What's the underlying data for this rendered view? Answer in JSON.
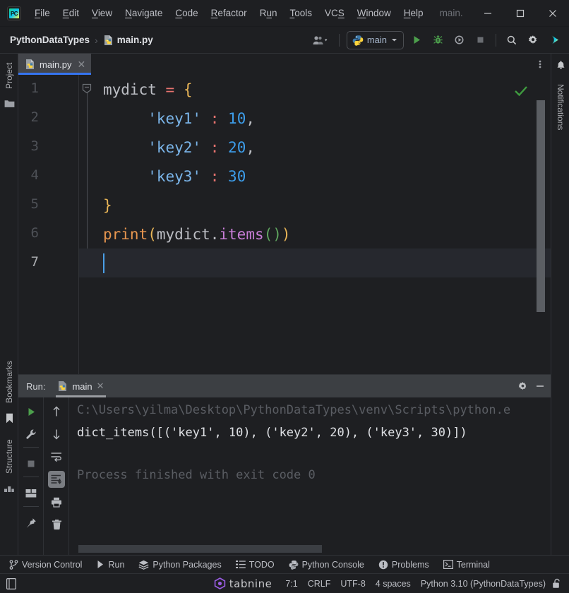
{
  "window": {
    "app_icon": "pycharm-logo-icon",
    "project_title_dim": "main.",
    "minimize": "minimize-icon",
    "maximize": "maximize-icon",
    "close": "close-icon"
  },
  "menu": {
    "items": [
      {
        "label": "File",
        "mnemonic": "F"
      },
      {
        "label": "Edit",
        "mnemonic": "E"
      },
      {
        "label": "View",
        "mnemonic": "V"
      },
      {
        "label": "Navigate",
        "mnemonic": "N"
      },
      {
        "label": "Code",
        "mnemonic": "C"
      },
      {
        "label": "Refactor",
        "mnemonic": "R"
      },
      {
        "label": "Run",
        "mnemonic": "u"
      },
      {
        "label": "Tools",
        "mnemonic": "T"
      },
      {
        "label": "VCS",
        "mnemonic": "S"
      },
      {
        "label": "Window",
        "mnemonic": "W"
      },
      {
        "label": "Help",
        "mnemonic": "H"
      }
    ]
  },
  "navbar": {
    "project": "PythonDataTypes",
    "separator": "›",
    "file": "main.py",
    "account_icon": "user-account-icon",
    "run_config": {
      "icon": "python-file-icon",
      "name": "main",
      "chevron": "chevron-down-icon"
    },
    "actions": [
      {
        "name": "run-button",
        "icon": "run-play-icon",
        "label": "Run"
      },
      {
        "name": "debug-button",
        "icon": "debug-bug-icon",
        "label": "Debug"
      },
      {
        "name": "run-with-coverage-button",
        "icon": "coverage-icon",
        "label": "Run with Coverage"
      },
      {
        "name": "stop-button",
        "icon": "stop-square-icon",
        "label": "Stop"
      },
      {
        "name": "search-everywhere-button",
        "icon": "search-icon",
        "label": "Search Everywhere"
      },
      {
        "name": "settings-button",
        "icon": "gear-icon",
        "label": "Settings"
      },
      {
        "name": "ai-assistant-button",
        "icon": "colored-play-icon",
        "label": "AI Assistant"
      }
    ]
  },
  "left_rail": {
    "project_label": "Project",
    "project_icon": "folder-icon",
    "bookmarks_label": "Bookmarks",
    "bookmarks_icon": "bookmark-icon",
    "structure_label": "Structure",
    "structure_icon": "structure-icon"
  },
  "right_rail": {
    "notifications_label": "Notifications",
    "notifications_icon": "bell-icon"
  },
  "editor_tabs": {
    "tabs": [
      {
        "label": "main.py",
        "icon": "python-file-icon",
        "close": "close-icon",
        "active": true
      }
    ],
    "more_icon": "more-vertical-icon"
  },
  "editor": {
    "inspection_status_icon": "green-check-icon",
    "lines": [
      {
        "n": "1",
        "current": false
      },
      {
        "n": "2",
        "current": false
      },
      {
        "n": "3",
        "current": false
      },
      {
        "n": "4",
        "current": false
      },
      {
        "n": "5",
        "current": false
      },
      {
        "n": "6",
        "current": false
      },
      {
        "n": "7",
        "current": true
      }
    ],
    "code": {
      "l1_var": "mydict",
      "l1_eq": "=",
      "l1_brace": "{",
      "l2_str": "'key1'",
      "l2_colon": ":",
      "l2_num": "10",
      "l2_comma": ",",
      "l3_str": "'key2'",
      "l3_colon": ":",
      "l3_num": "20",
      "l3_comma": ",",
      "l4_str": "'key3'",
      "l4_colon": ":",
      "l4_num": "30",
      "l5_brace": "}",
      "l6_fn": "print",
      "l6_open": "(",
      "l6_var": "mydict",
      "l6_dot": ".",
      "l6_meth": "items",
      "l6_parens": "()",
      "l6_close": ")"
    }
  },
  "run_panel": {
    "title": "Run:",
    "tab": {
      "label": "main",
      "icon": "python-file-icon",
      "close": "close-icon"
    },
    "settings_icon": "gear-icon",
    "minimize_icon": "minimize-icon",
    "toolbar_col1": [
      {
        "name": "rerun-button",
        "icon": "run-play-icon"
      },
      {
        "name": "modify-run-configuration-button",
        "icon": "wrench-icon"
      },
      {
        "name": "stop-button",
        "icon": "stop-square-icon"
      },
      {
        "name": "layout-button",
        "icon": "layout-icon"
      },
      {
        "name": "pin-tab-button",
        "icon": "pin-icon"
      }
    ],
    "toolbar_col2": [
      {
        "name": "up-button",
        "icon": "arrow-up-icon"
      },
      {
        "name": "down-button",
        "icon": "arrow-down-icon"
      },
      {
        "name": "soft-wrap-button",
        "icon": "soft-wrap-icon"
      },
      {
        "name": "scroll-to-end-button",
        "icon": "scroll-to-end-icon",
        "active": true
      },
      {
        "name": "print-button",
        "icon": "print-icon"
      },
      {
        "name": "clear-all-button",
        "icon": "trash-icon"
      }
    ],
    "console": {
      "command": "C:\\Users\\yilma\\Desktop\\PythonDataTypes\\venv\\Scripts\\python.e",
      "output": "dict_items([('key1', 10), ('key2', 20), ('key3', 30)])",
      "exit": "Process finished with exit code 0"
    }
  },
  "bottom_toolwindows": [
    {
      "label": "Version Control",
      "icon": "branch-icon"
    },
    {
      "label": "Run",
      "icon": "run-play-icon"
    },
    {
      "label": "Python Packages",
      "icon": "packages-icon"
    },
    {
      "label": "TODO",
      "icon": "todo-list-icon"
    },
    {
      "label": "Python Console",
      "icon": "python-console-icon"
    },
    {
      "label": "Problems",
      "icon": "problems-icon"
    },
    {
      "label": "Terminal",
      "icon": "terminal-icon"
    }
  ],
  "status_bar": {
    "left_icon": "reader-mode-icon",
    "tabnine": "tabnine",
    "tabnine_icon": "tabnine-logo-icon",
    "caret": "7:1",
    "line_separator": "CRLF",
    "encoding": "UTF-8",
    "indent": "4 spaces",
    "interpreter": "Python 3.10 (PythonDataTypes)",
    "lock_icon": "unlocked-padlock-icon"
  },
  "colors": {
    "accent_blue": "#3574f0",
    "bg": "#1e1f22",
    "panel": "#3c3f43",
    "text": "#bcbec4",
    "green": "#5fa65f",
    "string": "#7ab4e8",
    "number": "#3d9dea",
    "brace": "#e8b557",
    "operator": "#e8736f",
    "function": "#e8964f",
    "method": "#c77dd6",
    "tabnine": "#9b5de5"
  }
}
